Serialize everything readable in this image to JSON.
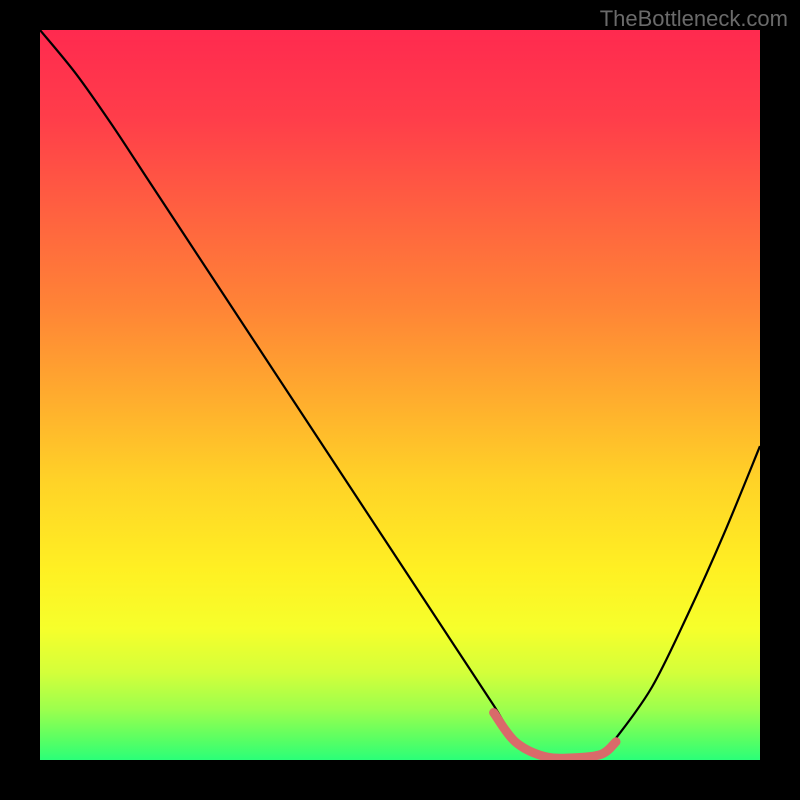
{
  "watermark": "TheBottleneck.com",
  "chart_data": {
    "type": "line",
    "title": "",
    "xlabel": "",
    "ylabel": "",
    "xlim": [
      0,
      100
    ],
    "ylim": [
      0,
      100
    ],
    "series": [
      {
        "name": "bottleneck-curve",
        "x": [
          0,
          5,
          10,
          15,
          20,
          25,
          30,
          35,
          40,
          45,
          50,
          55,
          60,
          63,
          66,
          70,
          74,
          78,
          80,
          85,
          90,
          95,
          100
        ],
        "values": [
          100,
          94,
          87,
          79.5,
          72,
          64.5,
          57,
          49.5,
          42,
          34.5,
          27,
          19.5,
          12,
          7.5,
          3,
          0.5,
          0,
          0.8,
          3,
          10,
          20,
          31,
          43
        ]
      },
      {
        "name": "optimal-range-marker",
        "x": [
          63,
          66,
          70,
          74,
          78,
          80
        ],
        "values": [
          6.5,
          2.5,
          0.5,
          0.3,
          0.8,
          2.5
        ]
      }
    ],
    "gradient_stops": [
      {
        "offset": 0.0,
        "color": "#ff2a4f"
      },
      {
        "offset": 0.12,
        "color": "#ff3d4a"
      },
      {
        "offset": 0.25,
        "color": "#ff6140"
      },
      {
        "offset": 0.38,
        "color": "#ff8436"
      },
      {
        "offset": 0.5,
        "color": "#ffab2e"
      },
      {
        "offset": 0.62,
        "color": "#ffd327"
      },
      {
        "offset": 0.74,
        "color": "#fff023"
      },
      {
        "offset": 0.82,
        "color": "#f6ff2b"
      },
      {
        "offset": 0.88,
        "color": "#d4ff3a"
      },
      {
        "offset": 0.93,
        "color": "#9dff4d"
      },
      {
        "offset": 0.97,
        "color": "#5cff62"
      },
      {
        "offset": 1.0,
        "color": "#2bff78"
      }
    ],
    "marker_color": "#d96a6a",
    "curve_color": "#000000"
  }
}
